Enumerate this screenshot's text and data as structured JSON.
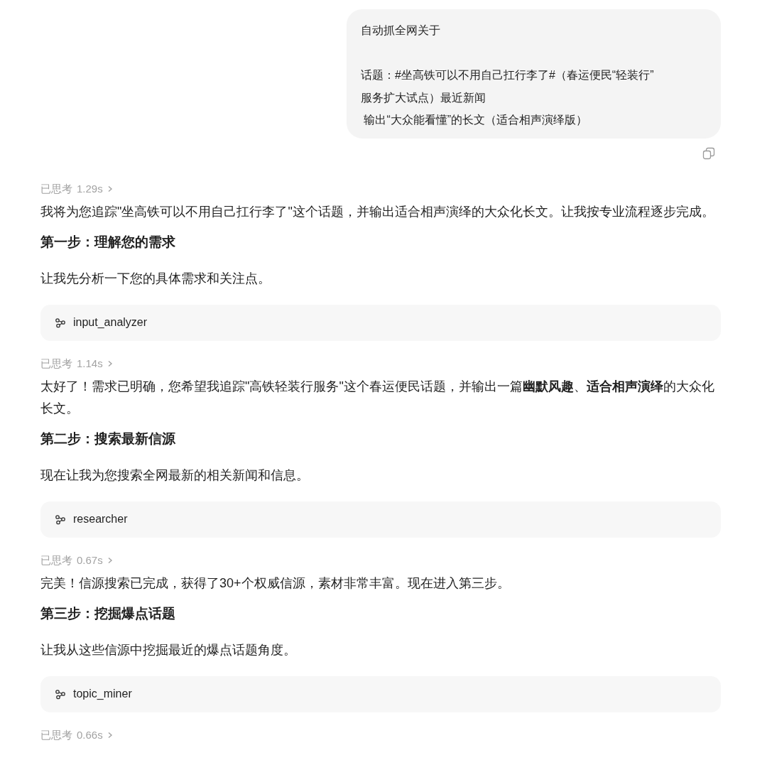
{
  "user_message": {
    "paragraphs": [
      [
        "自动抓全网关于"
      ],
      [
        "话题：#坐高铁可以不用自己扛行李了#（春运便民“轻装行”",
        "服务扩大试点）最近新闻",
        " 输出“大众能看懂”的长文（适合相声演绎版）"
      ]
    ]
  },
  "blocks": [
    {
      "kind": "thought",
      "label": "已思考",
      "time": "1.29s"
    },
    {
      "kind": "paragraph",
      "text": "我将为您追踪\"坐高铁可以不用自己扛行李了\"这个话题，并输出适合相声演绎的大众化长文。让我按专业流程逐步完成。"
    },
    {
      "kind": "heading",
      "text": "第一步：理解您的需求"
    },
    {
      "kind": "paragraph",
      "text": "让我先分析一下您的具体需求和关注点。"
    },
    {
      "kind": "tool",
      "name": "input_analyzer"
    },
    {
      "kind": "thought",
      "label": "已思考",
      "time": "1.14s"
    },
    {
      "kind": "paragraph",
      "text": "太好了！需求已明确，您希望我追踪\"高铁轻装行服务\"这个春运便民话题，并输出一篇**幽默风趣**、**适合相声演绎**的大众化长文。"
    },
    {
      "kind": "heading",
      "text": "第二步：搜索最新信源"
    },
    {
      "kind": "paragraph",
      "text": "现在让我为您搜索全网最新的相关新闻和信息。"
    },
    {
      "kind": "tool",
      "name": "researcher"
    },
    {
      "kind": "thought",
      "label": "已思考",
      "time": "0.67s"
    },
    {
      "kind": "paragraph",
      "text": "完美！信源搜索已完成，获得了30+个权威信源，素材非常丰富。现在进入第三步。"
    },
    {
      "kind": "heading",
      "text": "第三步：挖掘爆点话题"
    },
    {
      "kind": "paragraph",
      "text": "让我从这些信源中挖掘最近的爆点话题角度。"
    },
    {
      "kind": "tool",
      "name": "topic_miner"
    },
    {
      "kind": "thought",
      "label": "已思考",
      "time": "0.66s"
    }
  ]
}
